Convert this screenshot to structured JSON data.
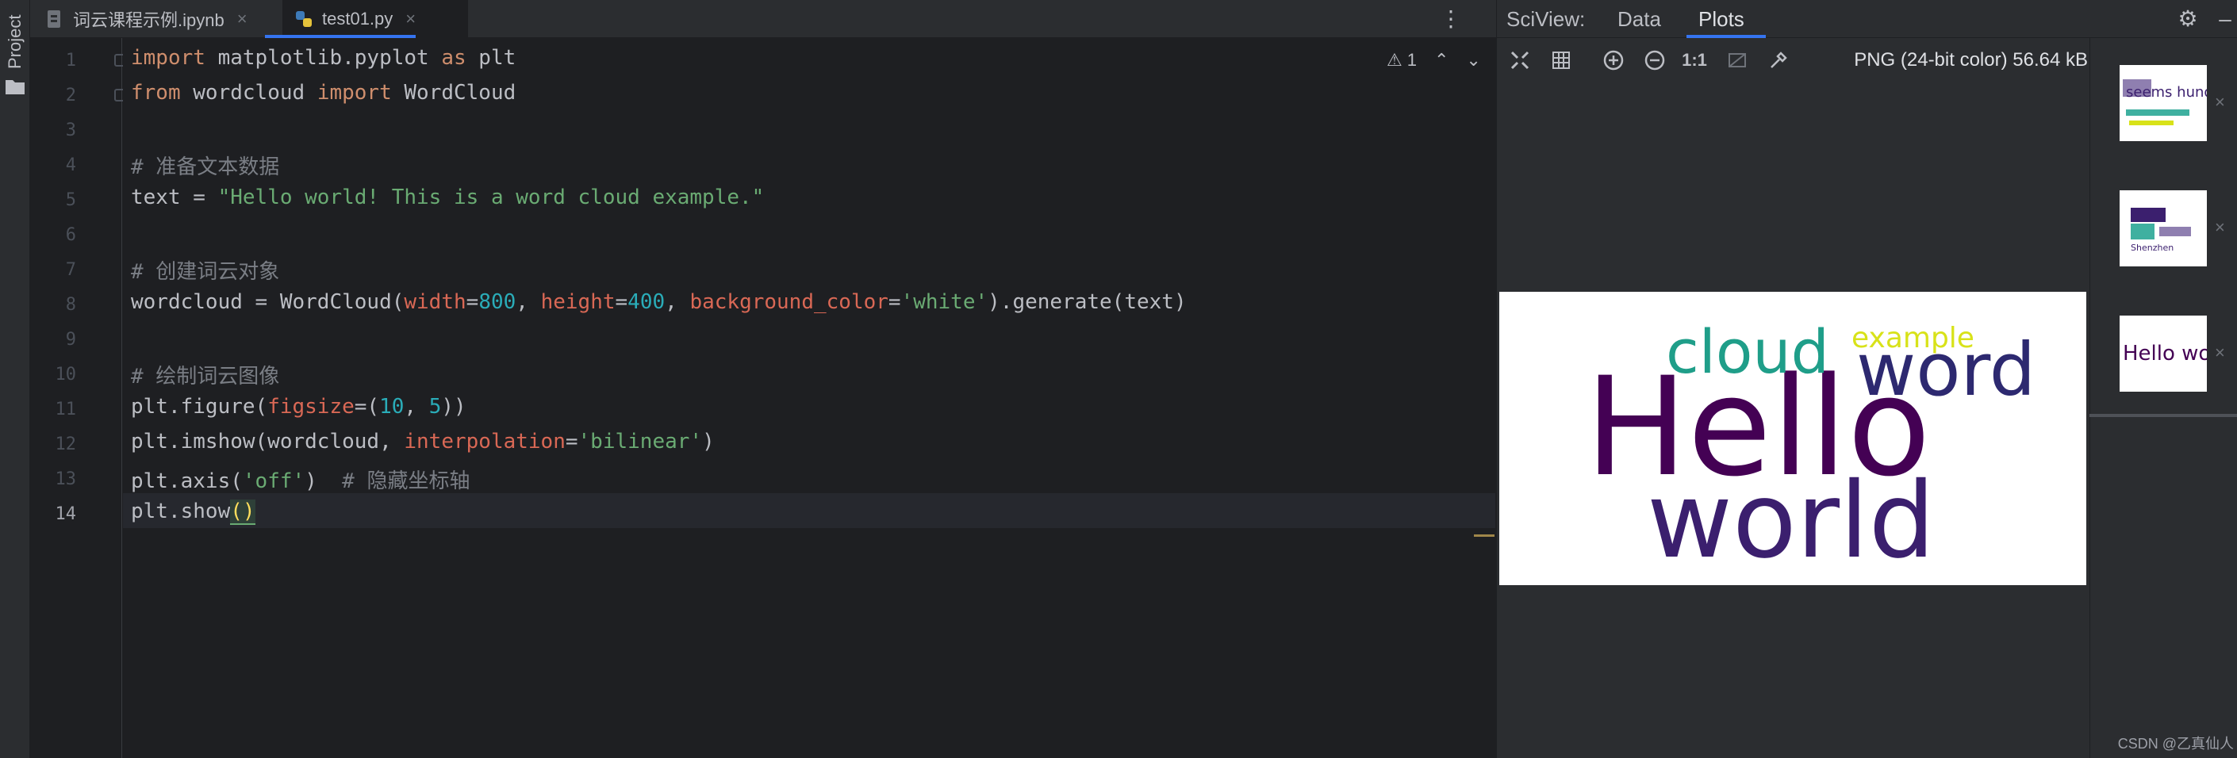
{
  "sidebar": {
    "project_label": "Project"
  },
  "tabs": [
    {
      "label": "词云课程示例.ipynb",
      "close": "×"
    },
    {
      "label": "test01.py",
      "close": "×"
    }
  ],
  "editor": {
    "warning_count": "1",
    "lines": [
      [
        "import",
        " matplotlib.pyplot ",
        "as",
        " plt"
      ],
      [
        "from",
        " wordcloud ",
        "import",
        " WordCloud"
      ],
      [],
      [
        "# 准备文本数据"
      ],
      [
        "text = ",
        "\"Hello world! This is a word cloud example.\""
      ],
      [],
      [
        "# 创建词云对象"
      ],
      [
        "wordcloud = WordCloud(",
        "width",
        "=",
        "800",
        ", ",
        "height",
        "=",
        "400",
        ", ",
        "background_color",
        "=",
        "'white'",
        ").generate(text)"
      ],
      [],
      [
        "# 绘制词云图像"
      ],
      [
        "plt.figure(",
        "figsize",
        "=(",
        "10",
        ", ",
        "5",
        "))"
      ],
      [
        "plt.imshow(wordcloud, ",
        "interpolation",
        "=",
        "'bilinear'",
        ")"
      ],
      [
        "plt.axis(",
        "'off'",
        ")  ",
        "# 隐藏坐标轴"
      ],
      [
        "plt.show",
        "()"
      ]
    ],
    "line_numbers": [
      "1",
      "2",
      "3",
      "4",
      "5",
      "6",
      "7",
      "8",
      "9",
      "10",
      "11",
      "12",
      "13",
      "14"
    ]
  },
  "sciview": {
    "title": "SciView:",
    "tab_data": "Data",
    "tab_plots": "Plots",
    "zoom_label": "1:1",
    "image_info": "PNG (24-bit color) 56.64 kB"
  },
  "wordcloud": {
    "words": [
      {
        "text": "Hello",
        "color": "#440154"
      },
      {
        "text": "world",
        "color": "#3b1f6e"
      },
      {
        "text": "word",
        "color": "#2d2970"
      },
      {
        "text": "cloud",
        "color": "#1f9e89"
      },
      {
        "text": "example",
        "color": "#d8e219"
      }
    ]
  },
  "thumbnails": [
    {
      "snippet": "seems hundre",
      "close": "×"
    },
    {
      "snippet": "Shenzhen",
      "close": "×"
    },
    {
      "snippet": "Hello world",
      "close": "×"
    }
  ],
  "watermark": "CSDN @乙真仙人"
}
